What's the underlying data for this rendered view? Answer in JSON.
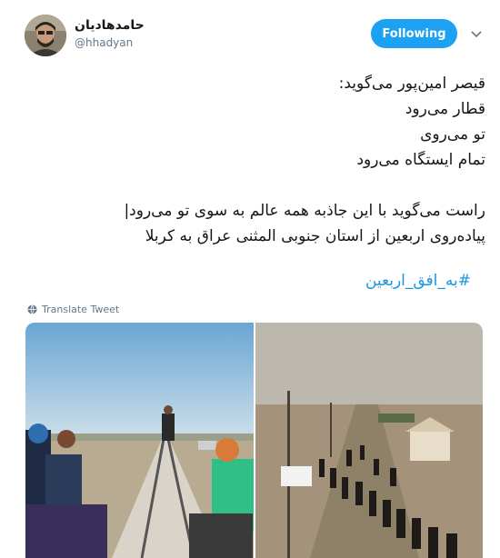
{
  "user": {
    "display_name": "حامدهادیان",
    "handle": "@hhadyan"
  },
  "follow_button": {
    "label": "Following"
  },
  "tweet": {
    "lines": [
      "قیصر امین‌پور می‌گوید:",
      "قطار می‌رود",
      "تو می‌روی",
      "تمام ایستگاه می‌رود",
      "",
      "راست می‌گوید با این جاذبه همه عالم به سوی تو می‌رود|",
      "پیاده‌روی اربعین از استان جنوبی المثنی عراق به کربلا"
    ],
    "hashtag": "#به_افق_اربعین"
  },
  "translate": {
    "label": "Translate Tweet"
  },
  "media": {
    "photos": [
      {
        "description": "railway-photo"
      },
      {
        "description": "pilgrims-crowd-photo"
      }
    ]
  },
  "colors": {
    "accent": "#1da1f2",
    "hashtag": "#1b95e0",
    "secondary_text": "#657786"
  },
  "icons": [
    "chevron-down-icon",
    "globe-icon"
  ]
}
